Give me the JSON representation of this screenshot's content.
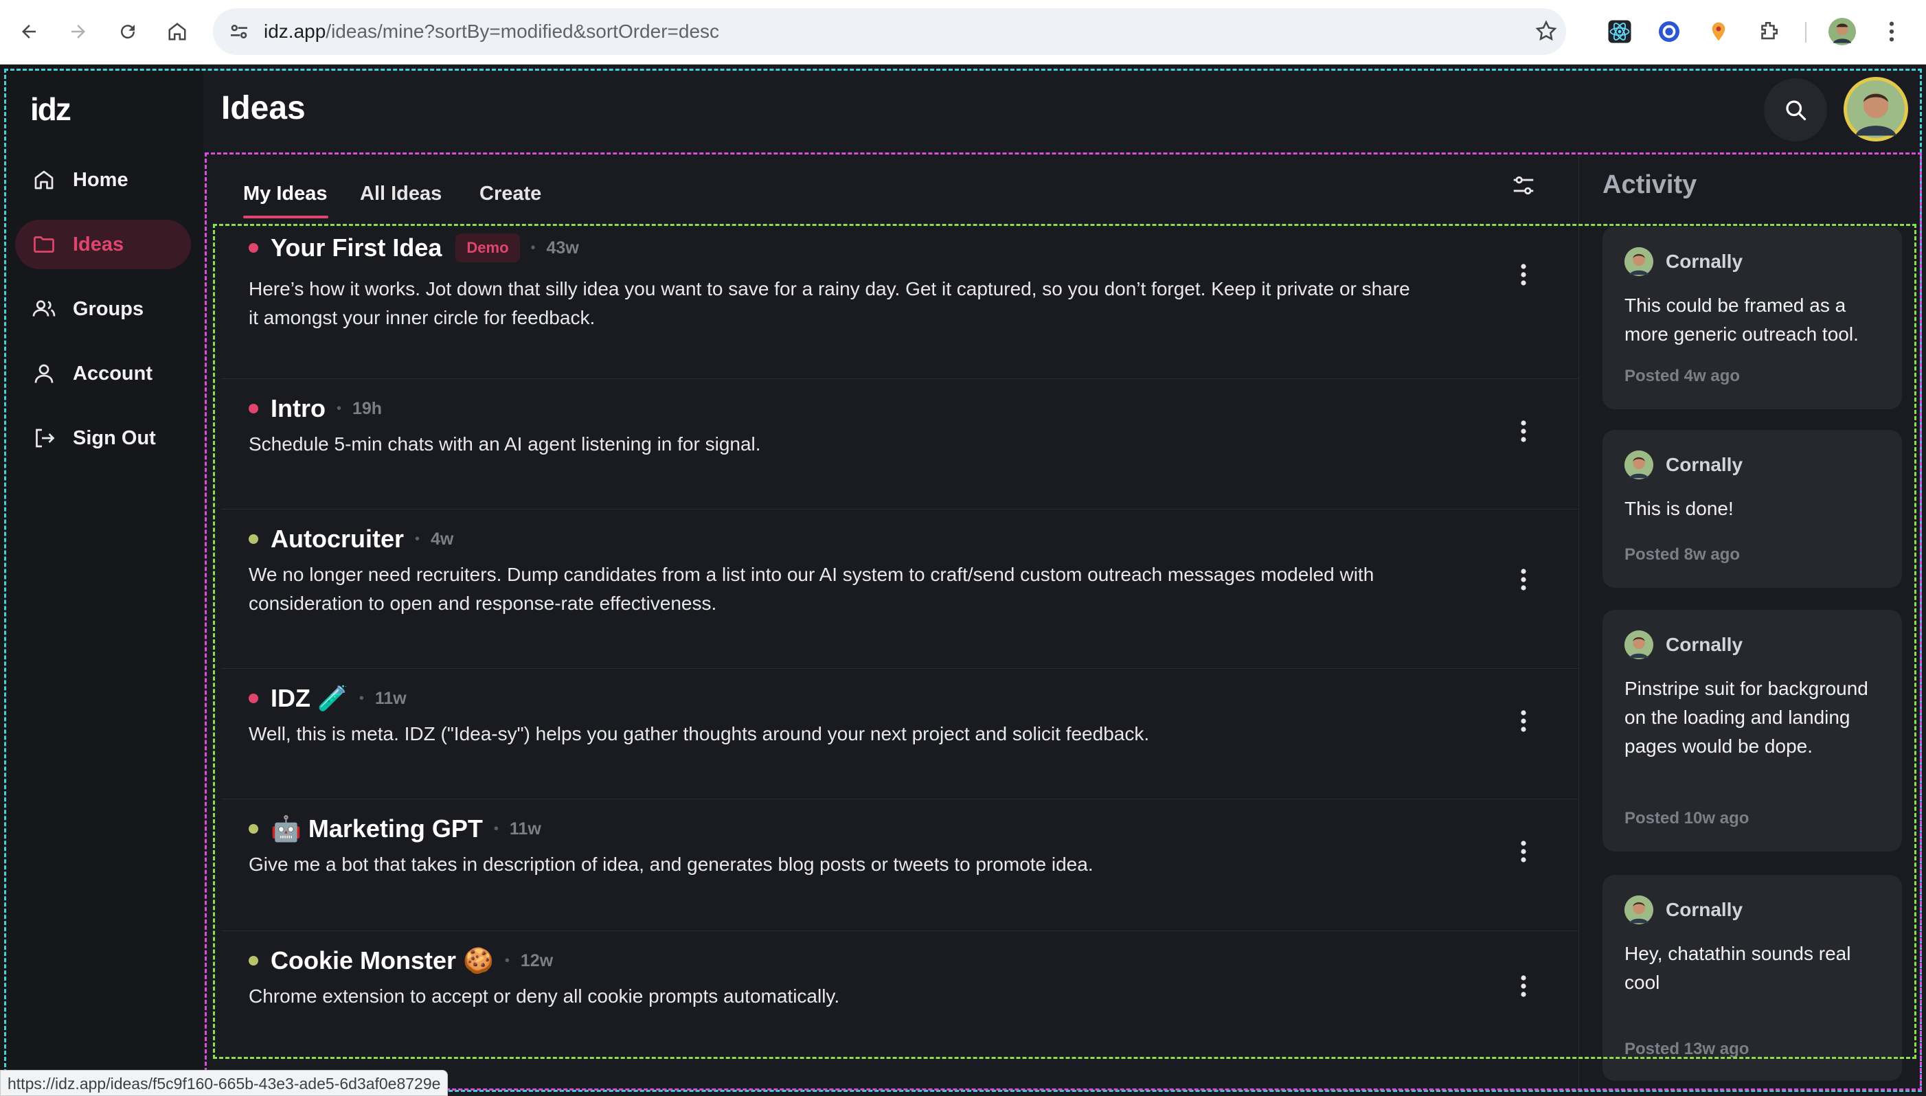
{
  "browser": {
    "url_host": "idz.app",
    "url_path": "/ideas/mine?sortBy=modified&sortOrder=desc",
    "status_link": "https://idz.app/ideas/f5c9f160-665b-43e3-ade5-6d3af0e8729e"
  },
  "app": {
    "logo": "idz",
    "page_title": "Ideas",
    "accent_color": "#e0466d"
  },
  "sidebar": {
    "items": [
      {
        "label": "Home",
        "icon": "home-icon"
      },
      {
        "label": "Ideas",
        "icon": "folder-icon",
        "active": true
      },
      {
        "label": "Groups",
        "icon": "users-icon"
      },
      {
        "label": "Account",
        "icon": "user-icon"
      },
      {
        "label": "Sign Out",
        "icon": "sign-out-icon"
      }
    ]
  },
  "tabs": [
    "My Ideas",
    "All Ideas",
    "Create"
  ],
  "ideas": [
    {
      "title": "Your First Idea",
      "badge": "Demo",
      "age": "43w",
      "status_color": "#e0466d",
      "description": "Here’s how it works.  Jot down that silly idea you want to save for a rainy day.  Get it captured, so you don’t forget.  Keep it private or share it amongst your inner circle for feedback."
    },
    {
      "title": "Intro",
      "age": "19h",
      "status_color": "#e0466d",
      "description": "Schedule 5-min chats with an AI agent listening in for signal."
    },
    {
      "title": "Autocruiter",
      "age": "4w",
      "status_color": "#b7c26a",
      "description": "We no longer need recruiters. Dump candidates from a list into our AI system to craft/send custom outreach messages modeled with consideration to open and response-rate effectiveness."
    },
    {
      "title": "IDZ 🧪",
      "age": "11w",
      "status_color": "#e0466d",
      "description": "Well, this is meta.  IDZ (\"Idea-sy\") helps you gather thoughts around your next project and solicit feedback."
    },
    {
      "title": "🤖 Marketing GPT",
      "age": "11w",
      "status_color": "#b7c26a",
      "description": "Give me a bot that takes in description of idea, and generates blog posts or tweets to promote idea."
    },
    {
      "title": "Cookie Monster 🍪",
      "age": "12w",
      "status_color": "#b7c26a",
      "description": "Chrome extension to accept or deny all cookie prompts automatically."
    }
  ],
  "activity": {
    "title": "Activity",
    "items": [
      {
        "user": "Cornally",
        "text": "This could be framed as a more generic outreach tool.",
        "time": "Posted 4w ago"
      },
      {
        "user": "Cornally",
        "text": "This is done!",
        "time": "Posted 8w ago"
      },
      {
        "user": "Cornally",
        "text": "Pinstripe suit for background on the loading and landing pages would be dope.",
        "time": "Posted 10w ago"
      },
      {
        "user": "Cornally",
        "text": "Hey, chatathin sounds real cool",
        "time": "Posted 13w ago"
      }
    ]
  }
}
